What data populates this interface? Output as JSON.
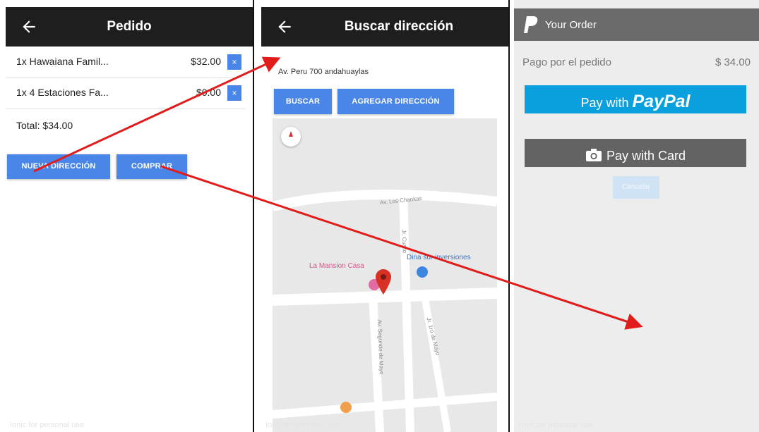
{
  "screen1": {
    "title": "Pedido",
    "items": [
      {
        "name": "1x Hawaiana Famil...",
        "price": "$32.00",
        "remove": "×"
      },
      {
        "name": "1x 4 Estaciones Fa...",
        "price": "$0.00",
        "remove": "×"
      }
    ],
    "total": "Total: $34.00",
    "new_address_button": "NUEVA DIRECCIÓN",
    "buy_button": "COMPRAR",
    "footer": "Ionic for personal use"
  },
  "screen2": {
    "title": "Buscar dirección",
    "address_value": "Av. Peru 700 andahuaylas",
    "search_button": "BUSCAR",
    "add_address_button": "AGREGAR DIRECCIÓN",
    "map": {
      "street_top": "Av. Los Chankas",
      "street_vertical": "Jr. Cuzco",
      "poi_mansion": "La Mansion Casa",
      "poi_sur": "Dina sur inversiones",
      "street_bottom_a": "Av. Segundo de Mayo",
      "street_bottom_b": "Jr. 1ro de Mayo"
    },
    "footer": "Ionic for personal use"
  },
  "screen3": {
    "header_title": "Your Order",
    "pay_label": "Pago por el pedido",
    "pay_amount": "$ 34.00",
    "paypal_lead": "Pay with ",
    "paypal_brand": "PayPal",
    "card_label": "Pay with Card",
    "small_button": "Cancelar",
    "footer": "Ionic for personal use"
  },
  "colors": {
    "appbar": "#1e1e1e",
    "ionic_blue": "#4a86e8",
    "paypal_blue": "#0aa0dd",
    "arrow_red": "#e21b1b"
  }
}
